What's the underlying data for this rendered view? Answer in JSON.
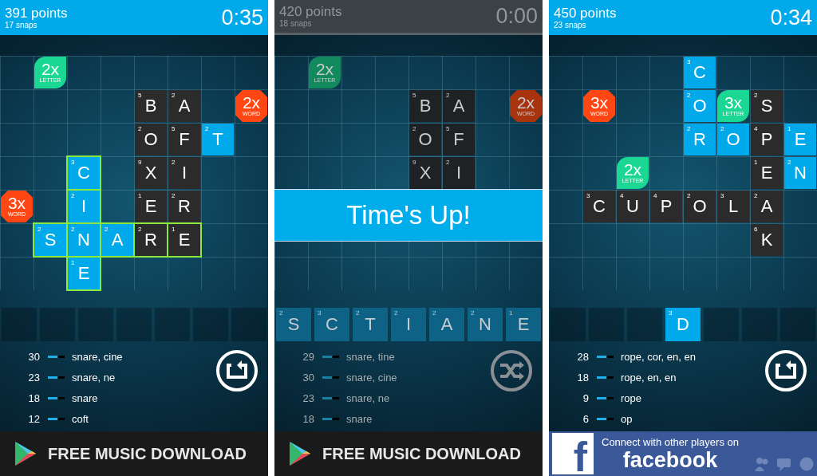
{
  "screens": [
    {
      "header": {
        "points": "391 points",
        "snaps": "17 snaps",
        "timer": "0:35"
      },
      "time_up": false,
      "board": [
        {
          "cells": [
            {
              "kind": "empty"
            },
            {
              "kind": "letter_bonus",
              "multiplier": "2x",
              "label": "LETTER"
            },
            {
              "kind": "empty"
            },
            {
              "kind": "empty"
            },
            {
              "kind": "empty"
            },
            {
              "kind": "empty"
            },
            {
              "kind": "empty"
            },
            {
              "kind": "empty"
            }
          ]
        },
        {
          "cells": [
            {
              "kind": "empty"
            },
            {
              "kind": "empty"
            },
            {
              "kind": "empty"
            },
            {
              "kind": "empty"
            },
            {
              "kind": "board_tile",
              "letter": "B",
              "points": "5",
              "outlined": false
            },
            {
              "kind": "board_tile",
              "letter": "A",
              "points": "2",
              "outlined": false
            },
            {
              "kind": "empty"
            },
            {
              "kind": "word_bonus",
              "multiplier": "2x",
              "label": "WORD"
            }
          ]
        },
        {
          "cells": [
            {
              "kind": "empty"
            },
            {
              "kind": "empty"
            },
            {
              "kind": "empty"
            },
            {
              "kind": "empty"
            },
            {
              "kind": "board_tile",
              "letter": "O",
              "points": "2",
              "outlined": false
            },
            {
              "kind": "board_tile",
              "letter": "F",
              "points": "5",
              "outlined": false
            },
            {
              "kind": "placed_tile",
              "letter": "T",
              "points": "2",
              "outlined": false
            },
            {
              "kind": "empty"
            }
          ]
        },
        {
          "cells": [
            {
              "kind": "empty"
            },
            {
              "kind": "empty"
            },
            {
              "kind": "placed_tile",
              "letter": "C",
              "points": "3",
              "outlined": true
            },
            {
              "kind": "empty"
            },
            {
              "kind": "board_tile",
              "letter": "X",
              "points": "9",
              "outlined": false
            },
            {
              "kind": "board_tile",
              "letter": "I",
              "points": "2",
              "outlined": false
            },
            {
              "kind": "empty"
            },
            {
              "kind": "empty"
            }
          ]
        },
        {
          "cells": [
            {
              "kind": "word_bonus",
              "multiplier": "3x",
              "label": "WORD"
            },
            {
              "kind": "empty"
            },
            {
              "kind": "placed_tile",
              "letter": "I",
              "points": "2",
              "outlined": true
            },
            {
              "kind": "empty"
            },
            {
              "kind": "board_tile",
              "letter": "E",
              "points": "1",
              "outlined": false
            },
            {
              "kind": "board_tile",
              "letter": "R",
              "points": "2",
              "outlined": false
            },
            {
              "kind": "empty"
            },
            {
              "kind": "empty"
            }
          ]
        },
        {
          "cells": [
            {
              "kind": "empty"
            },
            {
              "kind": "placed_tile",
              "letter": "S",
              "points": "2",
              "outlined": true
            },
            {
              "kind": "placed_tile",
              "letter": "N",
              "points": "2",
              "outlined": true
            },
            {
              "kind": "placed_tile",
              "letter": "A",
              "points": "2",
              "outlined": true
            },
            {
              "kind": "board_tile",
              "letter": "R",
              "points": "2",
              "outlined": true
            },
            {
              "kind": "board_tile",
              "letter": "E",
              "points": "1",
              "outlined": true
            },
            {
              "kind": "empty"
            },
            {
              "kind": "empty"
            }
          ]
        },
        {
          "cells": [
            {
              "kind": "empty"
            },
            {
              "kind": "empty"
            },
            {
              "kind": "placed_tile",
              "letter": "E",
              "points": "1",
              "outlined": true
            },
            {
              "kind": "empty"
            },
            {
              "kind": "empty"
            },
            {
              "kind": "empty"
            },
            {
              "kind": "empty"
            },
            {
              "kind": "empty"
            }
          ]
        }
      ],
      "tray": [
        {
          "kind": "empty"
        },
        {
          "kind": "empty"
        },
        {
          "kind": "empty"
        },
        {
          "kind": "empty"
        },
        {
          "kind": "empty"
        },
        {
          "kind": "empty"
        },
        {
          "kind": "empty"
        }
      ],
      "scores": [
        {
          "score": "30",
          "words": "snare, cine"
        },
        {
          "score": "23",
          "words": "snare, ne"
        },
        {
          "score": "18",
          "words": "snare"
        },
        {
          "score": "12",
          "words": "coft"
        }
      ],
      "action_button": {
        "kind": "recall"
      },
      "ad": {
        "kind": "music",
        "text": "FREE MUSIC DOWNLOAD"
      }
    },
    {
      "header": {
        "points": "420 points",
        "snaps": "18 snaps",
        "timer": "0:00"
      },
      "time_up": true,
      "banner": "Time's Up!",
      "board": [
        {
          "cells": [
            {
              "kind": "empty"
            },
            {
              "kind": "letter_bonus",
              "multiplier": "2x",
              "label": "LETTER"
            },
            {
              "kind": "empty"
            },
            {
              "kind": "empty"
            },
            {
              "kind": "empty"
            },
            {
              "kind": "empty"
            },
            {
              "kind": "empty"
            },
            {
              "kind": "empty"
            }
          ]
        },
        {
          "cells": [
            {
              "kind": "empty"
            },
            {
              "kind": "empty"
            },
            {
              "kind": "empty"
            },
            {
              "kind": "empty"
            },
            {
              "kind": "board_tile",
              "letter": "B",
              "points": "5",
              "outlined": false
            },
            {
              "kind": "board_tile",
              "letter": "A",
              "points": "2",
              "outlined": false
            },
            {
              "kind": "empty"
            },
            {
              "kind": "word_bonus",
              "multiplier": "2x",
              "label": "WORD"
            }
          ]
        },
        {
          "cells": [
            {
              "kind": "empty"
            },
            {
              "kind": "empty"
            },
            {
              "kind": "empty"
            },
            {
              "kind": "empty"
            },
            {
              "kind": "board_tile",
              "letter": "O",
              "points": "2",
              "outlined": false
            },
            {
              "kind": "board_tile",
              "letter": "F",
              "points": "5",
              "outlined": false
            },
            {
              "kind": "empty"
            },
            {
              "kind": "empty"
            }
          ]
        },
        {
          "cells": [
            {
              "kind": "empty"
            },
            {
              "kind": "empty"
            },
            {
              "kind": "empty"
            },
            {
              "kind": "empty"
            },
            {
              "kind": "board_tile",
              "letter": "X",
              "points": "9",
              "outlined": false
            },
            {
              "kind": "board_tile",
              "letter": "I",
              "points": "2",
              "outlined": false
            },
            {
              "kind": "empty"
            },
            {
              "kind": "empty"
            }
          ]
        },
        {
          "cells": [
            {
              "kind": "empty"
            },
            {
              "kind": "empty"
            },
            {
              "kind": "empty"
            },
            {
              "kind": "empty"
            },
            {
              "kind": "empty"
            },
            {
              "kind": "empty"
            },
            {
              "kind": "empty"
            },
            {
              "kind": "empty"
            }
          ]
        },
        {
          "cells": [
            {
              "kind": "empty"
            },
            {
              "kind": "empty"
            },
            {
              "kind": "empty"
            },
            {
              "kind": "empty"
            },
            {
              "kind": "empty"
            },
            {
              "kind": "empty"
            },
            {
              "kind": "empty"
            },
            {
              "kind": "empty"
            }
          ]
        },
        {
          "cells": [
            {
              "kind": "empty"
            },
            {
              "kind": "empty"
            },
            {
              "kind": "empty"
            },
            {
              "kind": "empty"
            },
            {
              "kind": "empty"
            },
            {
              "kind": "empty"
            },
            {
              "kind": "empty"
            },
            {
              "kind": "empty"
            }
          ]
        }
      ],
      "tray": [
        {
          "kind": "tile",
          "letter": "S",
          "points": "2"
        },
        {
          "kind": "tile",
          "letter": "C",
          "points": "3"
        },
        {
          "kind": "tile",
          "letter": "T",
          "points": "2"
        },
        {
          "kind": "tile",
          "letter": "I",
          "points": "2"
        },
        {
          "kind": "tile",
          "letter": "A",
          "points": "2"
        },
        {
          "kind": "tile",
          "letter": "N",
          "points": "2"
        },
        {
          "kind": "tile",
          "letter": "E",
          "points": "1"
        }
      ],
      "scores": [
        {
          "score": "29",
          "words": "snare, tine"
        },
        {
          "score": "30",
          "words": "snare, cine"
        },
        {
          "score": "23",
          "words": "snare, ne"
        },
        {
          "score": "18",
          "words": "snare"
        }
      ],
      "action_button": {
        "kind": "shuffle"
      },
      "ad": {
        "kind": "music",
        "text": "FREE MUSIC DOWNLOAD"
      }
    },
    {
      "header": {
        "points": "450 points",
        "snaps": "23 snaps",
        "timer": "0:34"
      },
      "time_up": false,
      "board": [
        {
          "cells": [
            {
              "kind": "empty"
            },
            {
              "kind": "empty"
            },
            {
              "kind": "empty"
            },
            {
              "kind": "empty"
            },
            {
              "kind": "placed_tile",
              "letter": "C",
              "points": "3",
              "outlined": false
            },
            {
              "kind": "empty"
            },
            {
              "kind": "empty"
            },
            {
              "kind": "empty"
            }
          ]
        },
        {
          "cells": [
            {
              "kind": "empty"
            },
            {
              "kind": "word_bonus",
              "multiplier": "3x",
              "label": "WORD"
            },
            {
              "kind": "empty"
            },
            {
              "kind": "empty"
            },
            {
              "kind": "placed_tile",
              "letter": "O",
              "points": "2",
              "outlined": false
            },
            {
              "kind": "letter_bonus",
              "multiplier": "3x",
              "label": "LETTER"
            },
            {
              "kind": "board_tile",
              "letter": "S",
              "points": "2",
              "outlined": false
            },
            {
              "kind": "empty"
            }
          ]
        },
        {
          "cells": [
            {
              "kind": "empty"
            },
            {
              "kind": "empty"
            },
            {
              "kind": "empty"
            },
            {
              "kind": "empty"
            },
            {
              "kind": "placed_tile",
              "letter": "R",
              "points": "2",
              "outlined": false
            },
            {
              "kind": "placed_tile",
              "letter": "O",
              "points": "2",
              "outlined": false
            },
            {
              "kind": "board_tile",
              "letter": "P",
              "points": "4",
              "outlined": false
            },
            {
              "kind": "placed_tile",
              "letter": "E",
              "points": "1",
              "outlined": false
            }
          ]
        },
        {
          "cells": [
            {
              "kind": "empty"
            },
            {
              "kind": "empty"
            },
            {
              "kind": "letter_bonus",
              "multiplier": "2x",
              "label": "LETTER"
            },
            {
              "kind": "empty"
            },
            {
              "kind": "empty"
            },
            {
              "kind": "empty"
            },
            {
              "kind": "board_tile",
              "letter": "E",
              "points": "1",
              "outlined": false
            },
            {
              "kind": "placed_tile",
              "letter": "N",
              "points": "2",
              "outlined": false
            }
          ]
        },
        {
          "cells": [
            {
              "kind": "empty"
            },
            {
              "kind": "board_tile",
              "letter": "C",
              "points": "3",
              "outlined": false
            },
            {
              "kind": "board_tile",
              "letter": "U",
              "points": "4",
              "outlined": false
            },
            {
              "kind": "board_tile",
              "letter": "P",
              "points": "4",
              "outlined": false
            },
            {
              "kind": "board_tile",
              "letter": "O",
              "points": "2",
              "outlined": false
            },
            {
              "kind": "board_tile",
              "letter": "L",
              "points": "3",
              "outlined": false
            },
            {
              "kind": "board_tile",
              "letter": "A",
              "points": "2",
              "outlined": false
            },
            {
              "kind": "empty"
            }
          ]
        },
        {
          "cells": [
            {
              "kind": "empty"
            },
            {
              "kind": "empty"
            },
            {
              "kind": "empty"
            },
            {
              "kind": "empty"
            },
            {
              "kind": "empty"
            },
            {
              "kind": "empty"
            },
            {
              "kind": "board_tile",
              "letter": "K",
              "points": "6",
              "outlined": false
            },
            {
              "kind": "empty"
            }
          ]
        },
        {
          "cells": [
            {
              "kind": "empty"
            },
            {
              "kind": "empty"
            },
            {
              "kind": "empty"
            },
            {
              "kind": "empty"
            },
            {
              "kind": "empty"
            },
            {
              "kind": "empty"
            },
            {
              "kind": "empty"
            },
            {
              "kind": "empty"
            }
          ]
        }
      ],
      "tray": [
        {
          "kind": "empty"
        },
        {
          "kind": "empty"
        },
        {
          "kind": "empty"
        },
        {
          "kind": "tile",
          "letter": "D",
          "points": "3"
        },
        {
          "kind": "empty"
        },
        {
          "kind": "empty"
        },
        {
          "kind": "empty"
        }
      ],
      "scores": [
        {
          "score": "28",
          "words": "rope, cor, en, en"
        },
        {
          "score": "18",
          "words": "rope, en, en"
        },
        {
          "score": "9",
          "words": "rope"
        },
        {
          "score": "6",
          "words": "op"
        }
      ],
      "action_button": {
        "kind": "recall"
      },
      "ad": {
        "kind": "facebook",
        "mark": "f",
        "caption": "Connect with other players on",
        "brand": "facebook"
      }
    }
  ]
}
